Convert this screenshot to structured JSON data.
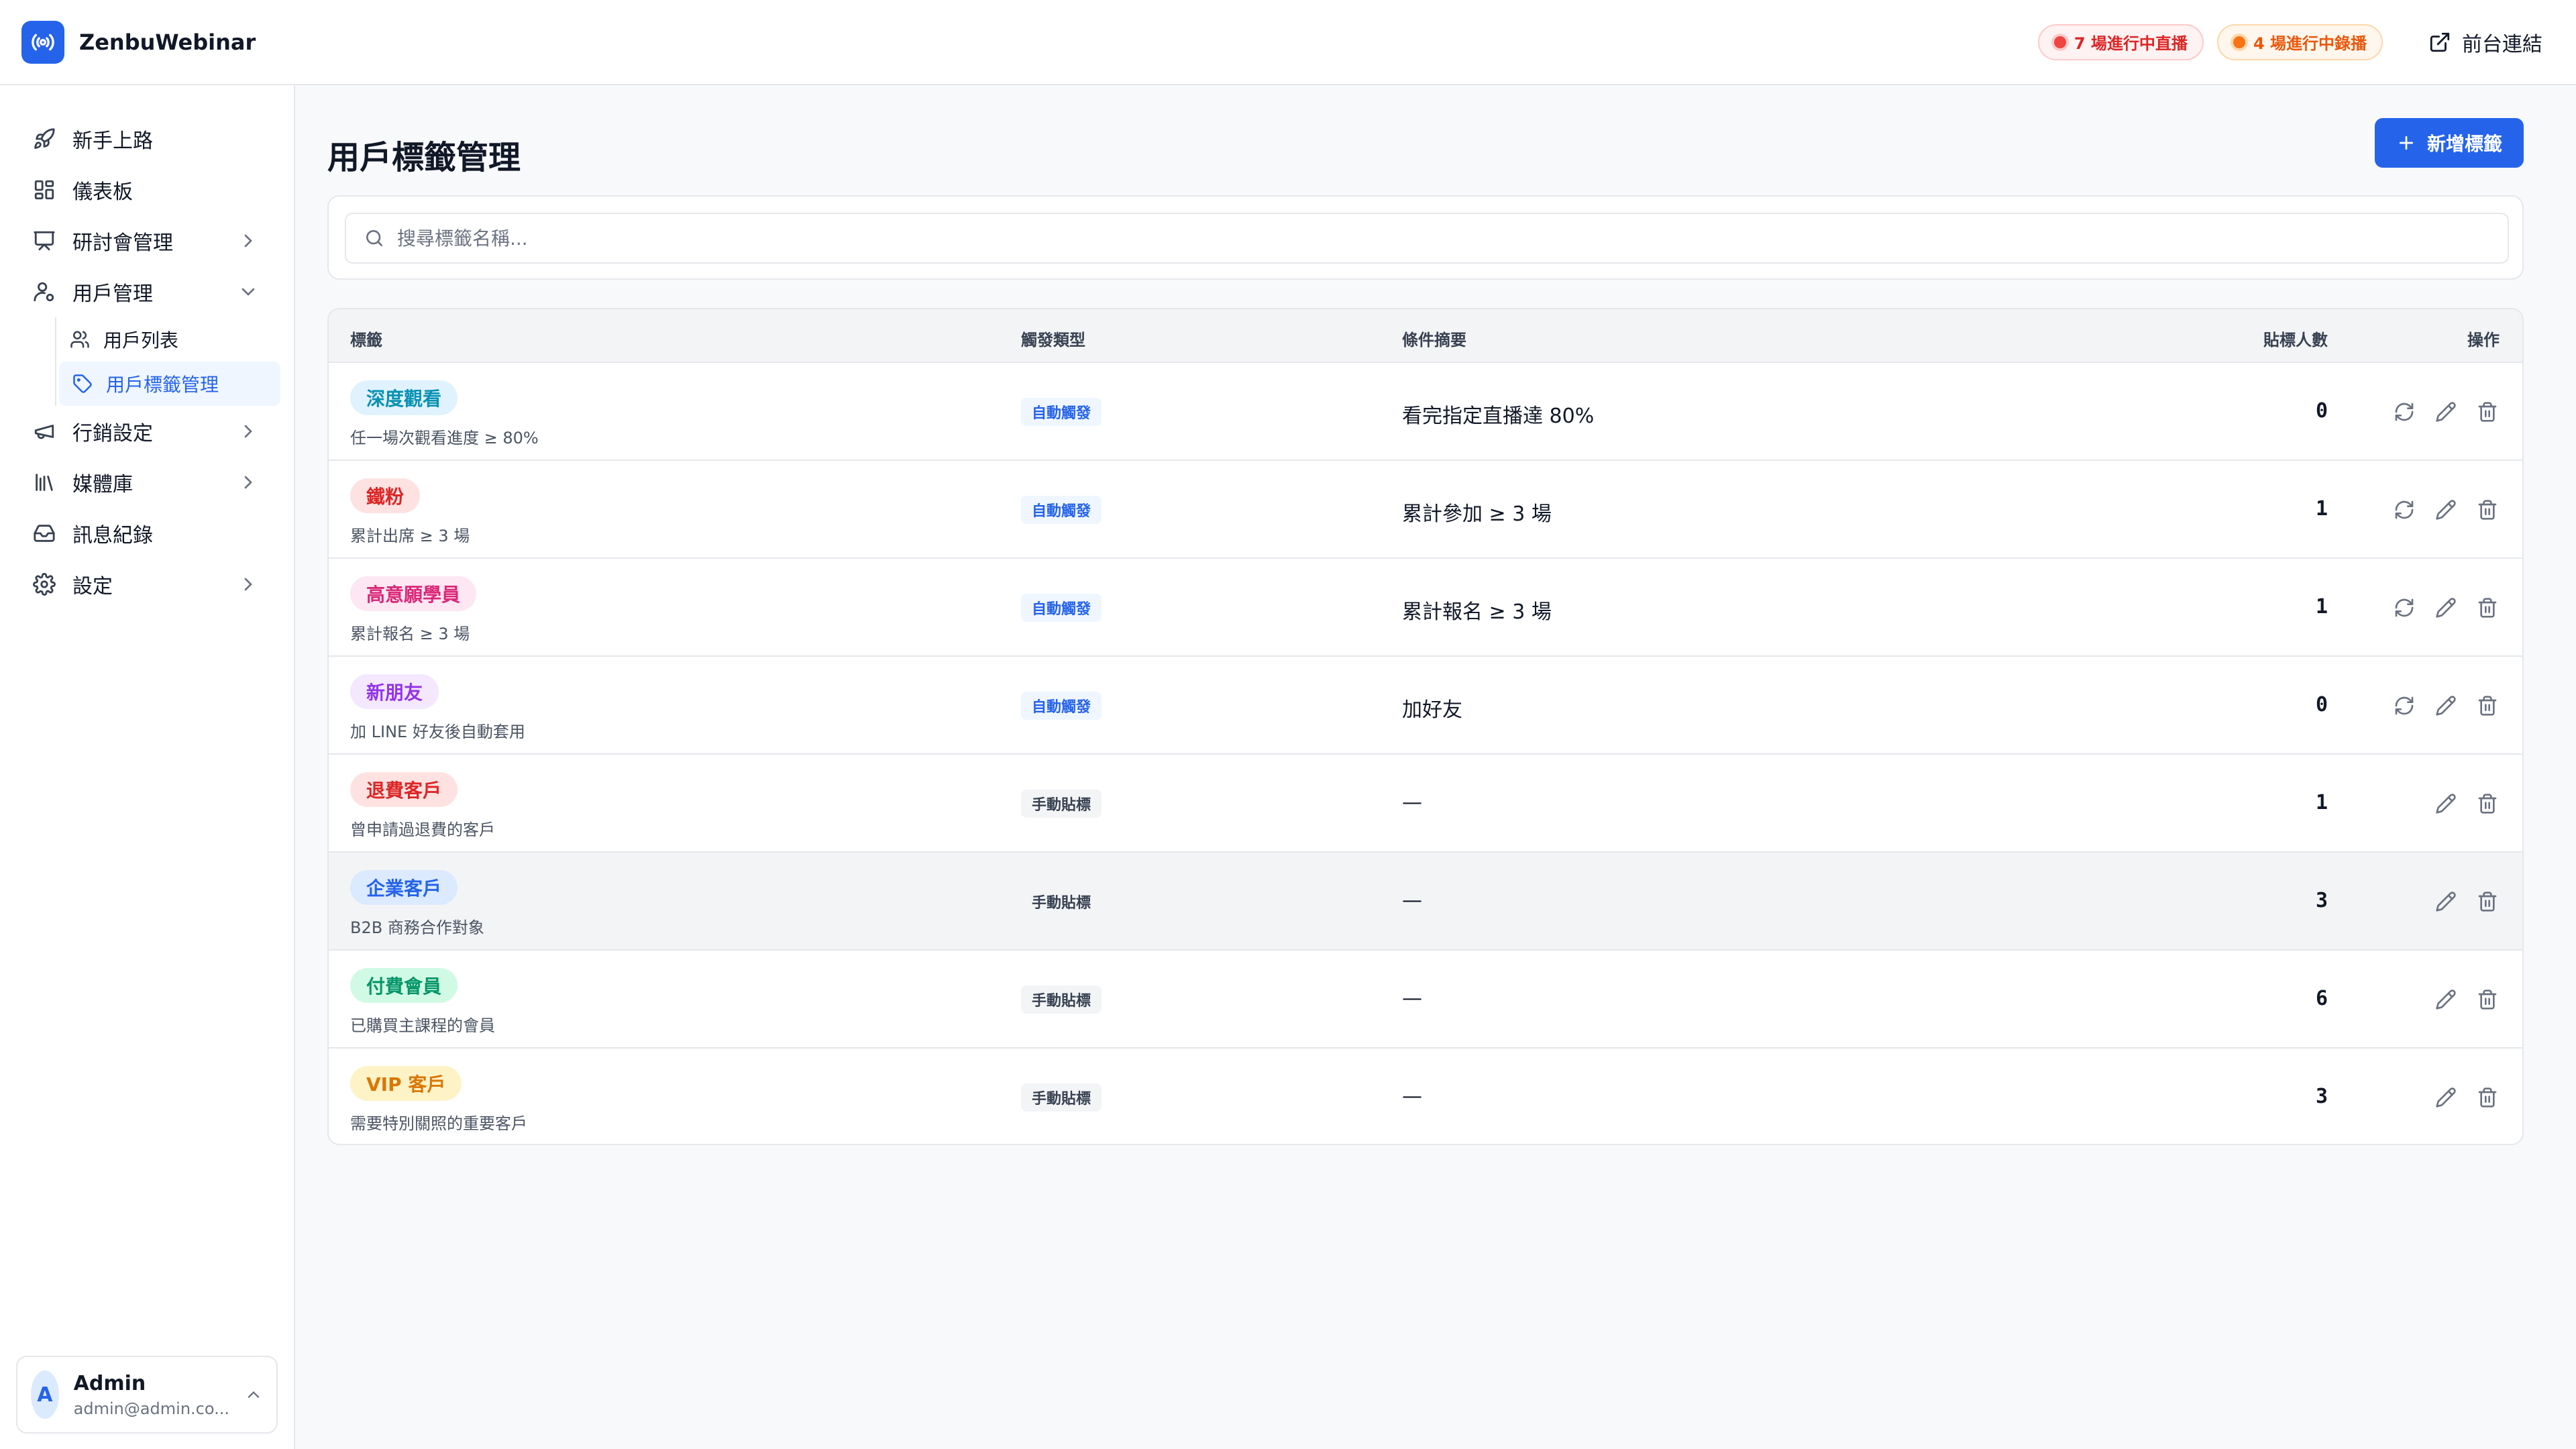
{
  "app": {
    "name": "ZenbuWebinar"
  },
  "topbar": {
    "live_label": "7 場進行中直播",
    "recording_label": "4 場進行中錄播",
    "front_link_label": "前台連結"
  },
  "sidebar": {
    "items": [
      {
        "label": "新手上路",
        "icon": "rocket-icon"
      },
      {
        "label": "儀表板",
        "icon": "dashboard-icon"
      },
      {
        "label": "研討會管理",
        "icon": "presentation-icon"
      },
      {
        "label": "用戶管理",
        "icon": "user-cog-icon"
      },
      {
        "label": "行銷設定",
        "icon": "megaphone-icon"
      },
      {
        "label": "媒體庫",
        "icon": "library-icon"
      },
      {
        "label": "訊息紀錄",
        "icon": "inbox-icon"
      },
      {
        "label": "設定",
        "icon": "gear-icon"
      }
    ],
    "sub_items": [
      {
        "label": "用戶列表",
        "icon": "users-icon"
      },
      {
        "label": "用戶標籤管理",
        "icon": "tag-icon"
      }
    ],
    "user": {
      "initial": "A",
      "name": "Admin",
      "email": "admin@admin.co..."
    }
  },
  "main": {
    "title": "用戶標籤管理",
    "add_button_label": "新增標籤",
    "search_placeholder": "搜尋標籤名稱...",
    "columns": {
      "tag": "標籤",
      "trigger": "觸發類型",
      "condition": "條件摘要",
      "count": "貼標人數",
      "actions": "操作"
    },
    "rows": [
      {
        "name": "深度觀看",
        "desc": "任一場次觀看進度 ≥ 80%",
        "type": "自動觸發",
        "condition": "看完指定直播達 80%",
        "count": "0",
        "color": "#0891b2",
        "bg": "#e0f2fe"
      },
      {
        "name": "鐵粉",
        "desc": "累計出席 ≥ 3 場",
        "type": "自動觸發",
        "condition": "累計參加 ≥ 3 場",
        "count": "1",
        "color": "#dc2626",
        "bg": "#fee2e2"
      },
      {
        "name": "高意願學員",
        "desc": "累計報名 ≥ 3 場",
        "type": "自動觸發",
        "condition": "累計報名 ≥ 3 場",
        "count": "1",
        "color": "#db2777",
        "bg": "#fce7f3"
      },
      {
        "name": "新朋友",
        "desc": "加 LINE 好友後自動套用",
        "type": "自動觸發",
        "condition": "加好友",
        "count": "0",
        "color": "#9333ea",
        "bg": "#f3e8ff"
      },
      {
        "name": "退費客戶",
        "desc": "曾申請過退費的客戶",
        "type": "手動貼標",
        "condition": "—",
        "count": "1",
        "color": "#dc2626",
        "bg": "#fee2e2"
      },
      {
        "name": "企業客戶",
        "desc": "B2B 商務合作對象",
        "type": "手動貼標",
        "condition": "—",
        "count": "3",
        "color": "#2563eb",
        "bg": "#dbeafe"
      },
      {
        "name": "付費會員",
        "desc": "已購買主課程的會員",
        "type": "手動貼標",
        "condition": "—",
        "count": "6",
        "color": "#059669",
        "bg": "#d1fae5"
      },
      {
        "name": "VIP 客戶",
        "desc": "需要特別關照的重要客戶",
        "type": "手動貼標",
        "condition": "—",
        "count": "3",
        "color": "#d97706",
        "bg": "#fef3c7"
      }
    ]
  },
  "colors": {
    "accent": "#2563eb",
    "live": "#dc2626",
    "recording": "#ea580c"
  }
}
